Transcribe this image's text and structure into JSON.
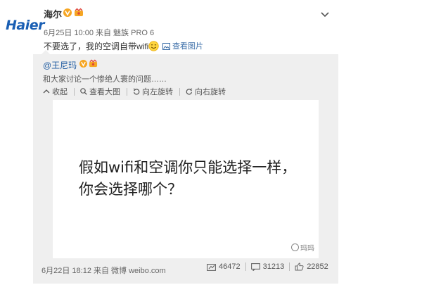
{
  "post": {
    "logo": "Haier",
    "user_name": "海尔",
    "meta": "6月25日 10:00 来自 魅族 PRO 6",
    "text": "不要选了，我的空调自带wifi",
    "view_image": "查看图片"
  },
  "repost": {
    "user": "@王尼玛",
    "text": "和大家讨论一个惨绝人寰的问题……",
    "toolbar": {
      "collapse": "收起",
      "view_large": "查看大图",
      "rotate_left": "向左旋转",
      "rotate_right": "向右旋转"
    },
    "image": {
      "line1": "假如wifi和空调你只能选择一样，",
      "line2": "你会选择哪个？",
      "watermark": "玛玛"
    },
    "footer_meta": "6月22日 18:12 来自 微博 weibo.com",
    "stats": {
      "reposts": "46472",
      "comments": "31213",
      "likes": "22852"
    }
  },
  "colors": {
    "link": "#3b6ea8",
    "verified": "#f6a623",
    "repost_bg": "#efefef"
  }
}
